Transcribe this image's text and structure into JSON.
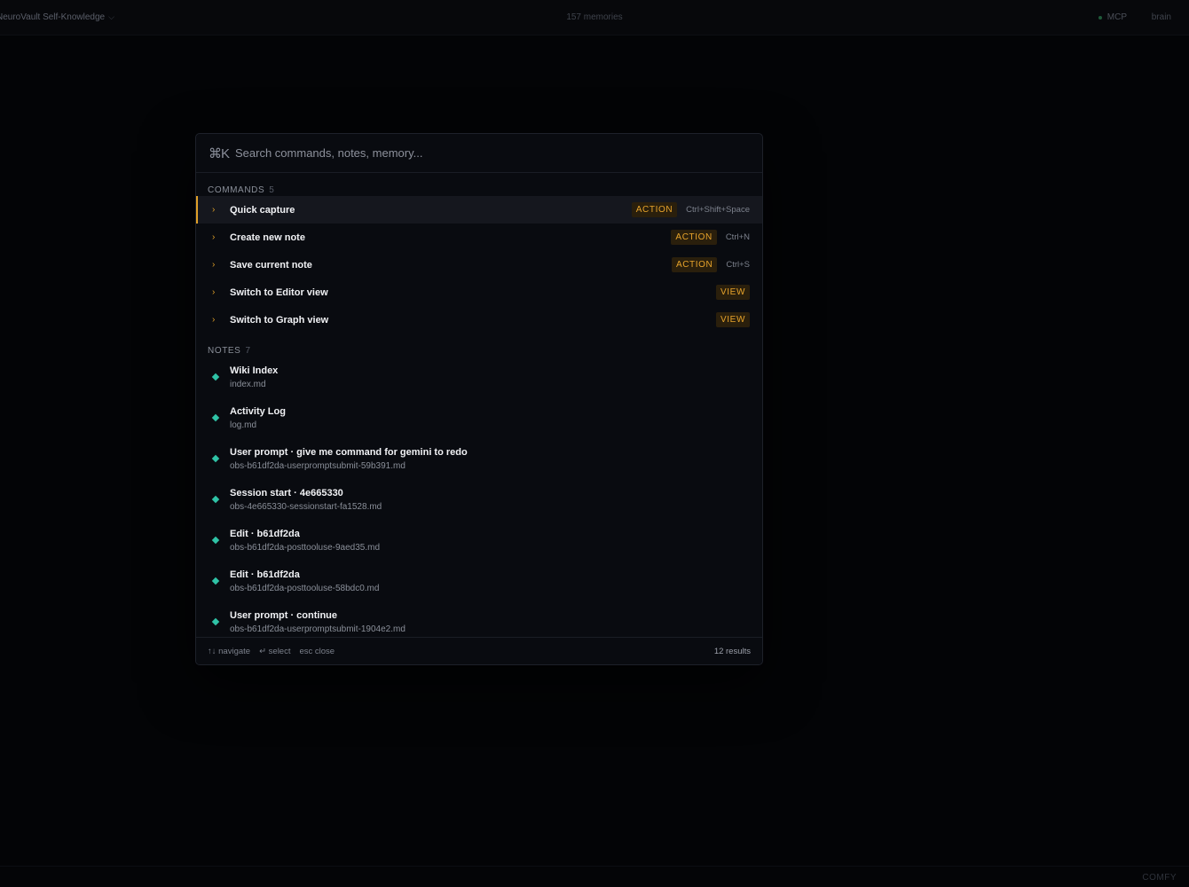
{
  "topbar": {
    "vault_name": "NeuroVault Self-Knowledge",
    "vault_chevron": "⌵",
    "memory_count": "157 memories",
    "mcp_label": "MCP",
    "brain_label": "brain"
  },
  "footer": {
    "label": "COMFY"
  },
  "palette": {
    "shortcut_icon": "⌘K",
    "search_placeholder": "Search commands, notes, memory...",
    "commands_header": "COMMANDS",
    "commands_count": "5",
    "commands": [
      {
        "label": "Quick capture",
        "badge": "ACTION",
        "shortcut": "Ctrl+Shift+Space",
        "active": true
      },
      {
        "label": "Create new note",
        "badge": "ACTION",
        "shortcut": "Ctrl+N"
      },
      {
        "label": "Save current note",
        "badge": "ACTION",
        "shortcut": "Ctrl+S"
      },
      {
        "label": "Switch to Editor view",
        "badge": "VIEW",
        "shortcut": ""
      },
      {
        "label": "Switch to Graph view",
        "badge": "VIEW",
        "shortcut": ""
      }
    ],
    "notes_header": "NOTES",
    "notes_count": "7",
    "notes": [
      {
        "title": "Wiki Index",
        "path": "index.md"
      },
      {
        "title": "Activity Log",
        "path": "log.md"
      },
      {
        "title": "User prompt · give me command for gemini to redo",
        "path": "obs-b61df2da-userpromptsubmit-59b391.md"
      },
      {
        "title": "Session start · 4e665330",
        "path": "obs-4e665330-sessionstart-fa1528.md"
      },
      {
        "title": "Edit · b61df2da",
        "path": "obs-b61df2da-posttooluse-9aed35.md"
      },
      {
        "title": "Edit · b61df2da",
        "path": "obs-b61df2da-posttooluse-58bdc0.md"
      },
      {
        "title": "User prompt · continue",
        "path": "obs-b61df2da-userpromptsubmit-1904e2.md"
      }
    ],
    "footer_hints": {
      "navigate": "↑↓ navigate",
      "select": "↵ select",
      "close": "esc close",
      "result_count": "12 results"
    }
  },
  "colors": {
    "accent": "#e0a028",
    "note_marker": "#2fc3a6",
    "background": "#030406",
    "panel": "#090b10"
  },
  "icons": {
    "command_chevron": "chevron-right-icon",
    "note_marker": "diamond-icon"
  }
}
